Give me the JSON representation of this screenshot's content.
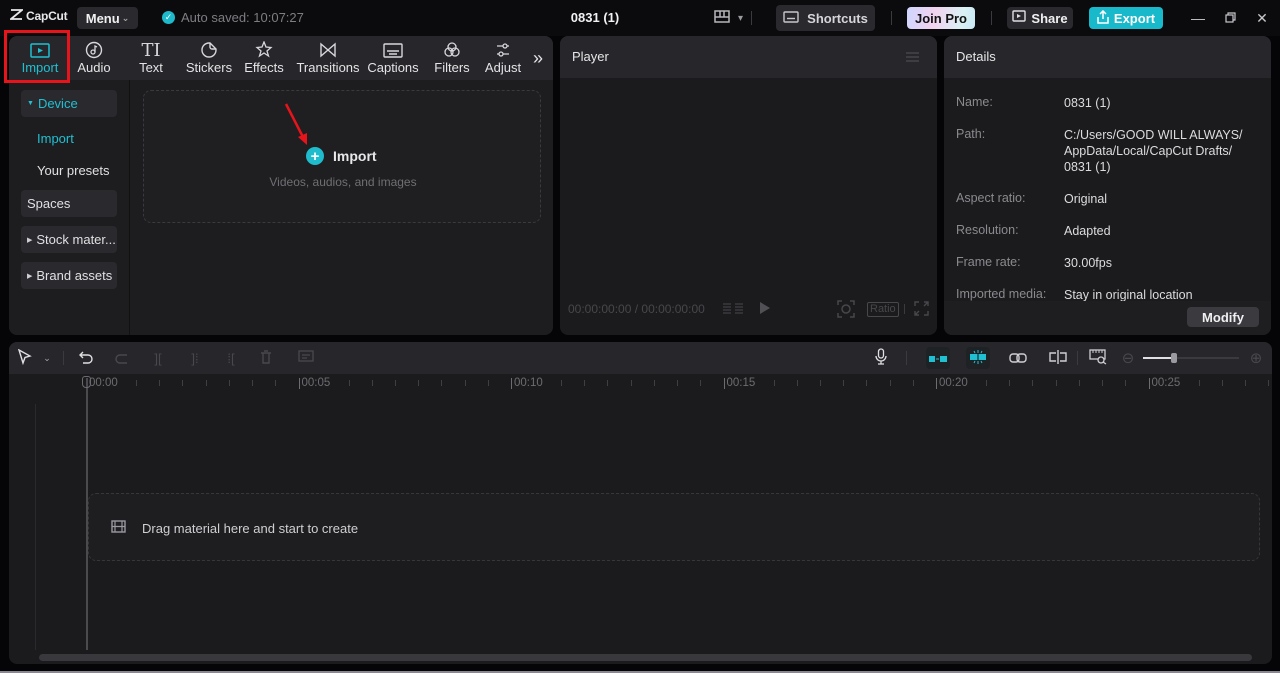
{
  "titlebar": {
    "app_name": "CapCut",
    "menu_label": "Menu",
    "autosave": "Auto saved: 10:07:27",
    "project_title": "0831 (1)",
    "shortcuts_label": "Shortcuts",
    "joinpro_label": "Join Pro",
    "share_label": "Share",
    "export_label": "Export",
    "colors": {
      "accent": "#18b9cb"
    }
  },
  "media": {
    "tabs": [
      {
        "label": "Import",
        "icon": "import-icon",
        "active": true
      },
      {
        "label": "Audio",
        "icon": "audio-icon"
      },
      {
        "label": "Text",
        "icon": "text-icon"
      },
      {
        "label": "Stickers",
        "icon": "stickers-icon"
      },
      {
        "label": "Effects",
        "icon": "effects-icon"
      },
      {
        "label": "Transitions",
        "icon": "transitions-icon"
      },
      {
        "label": "Captions",
        "icon": "captions-icon"
      },
      {
        "label": "Filters",
        "icon": "filters-icon"
      },
      {
        "label": "Adjust",
        "icon": "adjust-icon"
      }
    ],
    "sidebar": {
      "device": "Device",
      "import": "Import",
      "presets": "Your presets",
      "spaces": "Spaces",
      "stock": "Stock mater...",
      "brand": "Brand assets"
    },
    "dropzone": {
      "title": "Import",
      "subtitle": "Videos, audios, and images"
    }
  },
  "player": {
    "title": "Player",
    "timecode": "00:00:00:00 / 00:00:00:00",
    "ratio_label": "Ratio"
  },
  "details": {
    "title": "Details",
    "rows": [
      {
        "key": "Name:",
        "value": "0831 (1)"
      },
      {
        "key": "Path:",
        "value": "C:/Users/GOOD WILL ALWAYS/ AppData/Local/CapCut Drafts/ 0831 (1)"
      },
      {
        "key": "Aspect ratio:",
        "value": "Original"
      },
      {
        "key": "Resolution:",
        "value": "Adapted"
      },
      {
        "key": "Frame rate:",
        "value": "30.00fps"
      },
      {
        "key": "Imported media:",
        "value": "Stay in original location"
      }
    ],
    "modify_label": "Modify"
  },
  "timeline": {
    "ruler_labels": [
      "00:00",
      "00:05",
      "00:10",
      "00:15",
      "00:20",
      "00:25"
    ],
    "drag_hint": "Drag material here and start to create",
    "zoom_level": 0.32
  }
}
